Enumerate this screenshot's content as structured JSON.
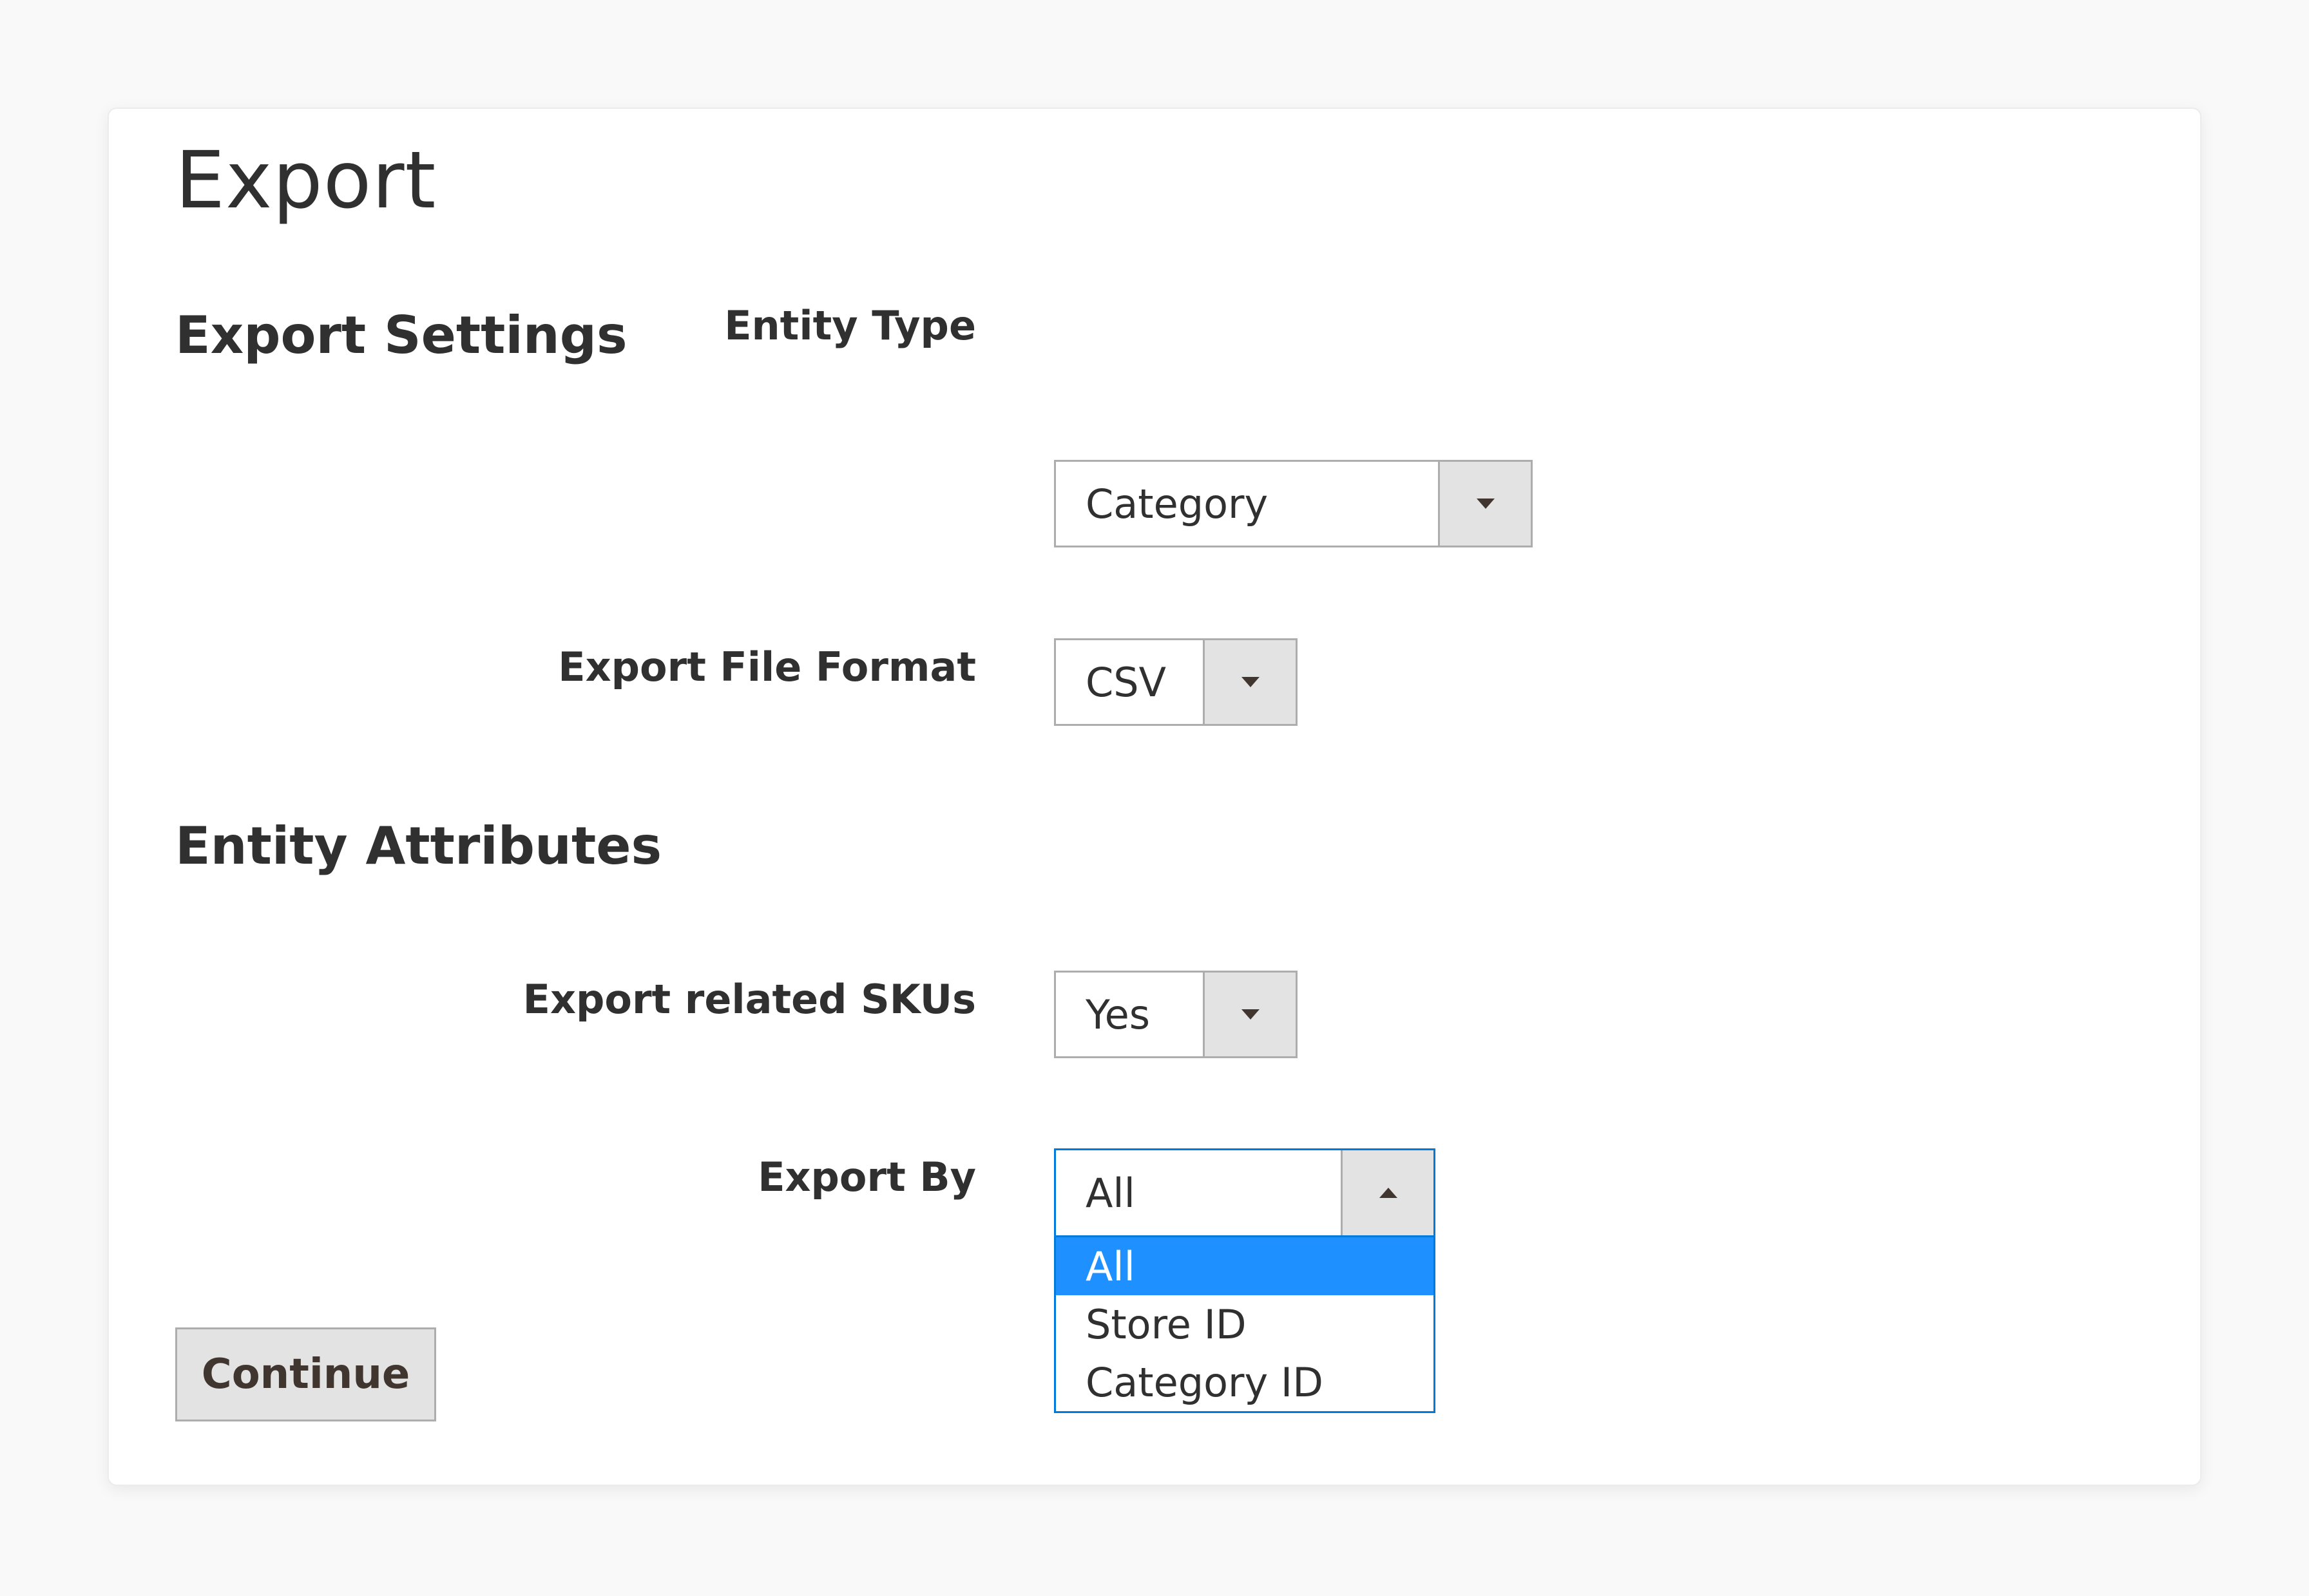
{
  "page": {
    "title": "Export"
  },
  "sections": {
    "export_settings": "Export Settings",
    "entity_attributes": "Entity Attributes"
  },
  "fields": {
    "entity_type": {
      "label": "Entity Type",
      "value": "Category"
    },
    "file_format": {
      "label": "Export File Format",
      "value": "CSV"
    },
    "related_skus": {
      "label": "Export related SKUs",
      "value": "Yes"
    },
    "export_by": {
      "label": "Export By",
      "value": "All",
      "options": [
        "All",
        "Store ID",
        "Category ID"
      ],
      "selected_option": "All",
      "expanded": true
    }
  },
  "buttons": {
    "continue": "Continue"
  },
  "icons": {
    "dropdown_closed": "chevron-down-icon",
    "dropdown_open": "chevron-up-icon"
  },
  "colors": {
    "focus_border": "#007bdb",
    "selected_option_bg": "#1e90ff",
    "button_bg": "#e3e3e3",
    "text": "#303030"
  }
}
